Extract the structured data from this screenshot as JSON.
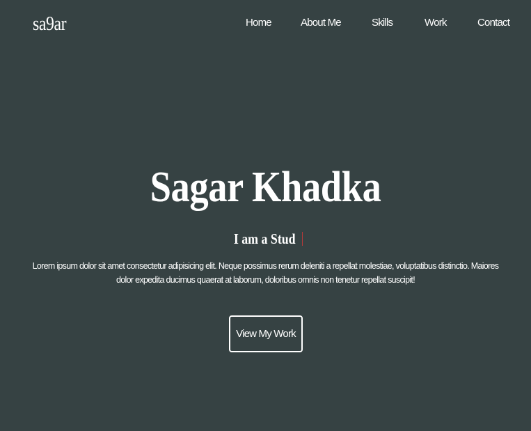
{
  "header": {
    "logo": "sa9ar",
    "nav": [
      {
        "label": "Home"
      },
      {
        "label": "About Me"
      },
      {
        "label": "Skills"
      },
      {
        "label": "Work"
      },
      {
        "label": "Contact"
      }
    ]
  },
  "hero": {
    "title": "Sagar Khadka",
    "subtitle": "I am a Stud",
    "description": "Lorem ipsum dolor sit amet consectetur adipisicing elit. Neque possimus rerum deleniti a repellat molestiae, voluptatibus distinctio. Maiores dolor expedita ducimus quaerat at laborum, doloribus omnis non tenetur repellat suscipit!",
    "cta_label": "View My Work"
  },
  "colors": {
    "background": "#364243",
    "text": "#ffffff",
    "cursor": "#b43a3a"
  }
}
